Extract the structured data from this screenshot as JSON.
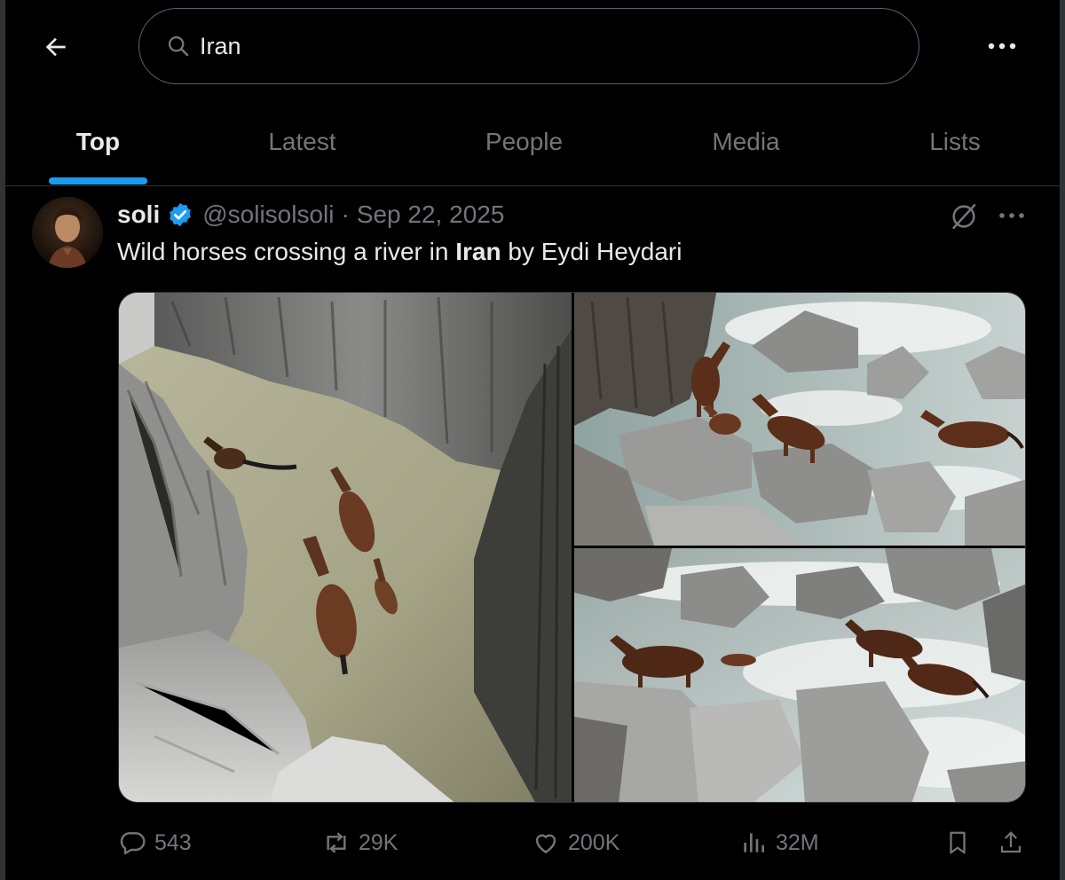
{
  "search": {
    "query": "Iran"
  },
  "tabs": [
    {
      "label": "Top",
      "active": true
    },
    {
      "label": "Latest",
      "active": false
    },
    {
      "label": "People",
      "active": false
    },
    {
      "label": "Media",
      "active": false
    },
    {
      "label": "Lists",
      "active": false
    }
  ],
  "post": {
    "author": "soli",
    "verified": true,
    "handle": "@solisolsoli",
    "separator": "·",
    "date": "Sep 22, 2025",
    "text_before": "Wild horses crossing a river in ",
    "text_highlight": "Iran",
    "text_after": " by Eydi Heydari",
    "media_count": 3,
    "actions": {
      "replies": "543",
      "reposts": "29K",
      "likes": "200K",
      "views": "32M"
    }
  },
  "icons": {
    "back": "arrow-left-icon",
    "search": "search-icon",
    "more": "more-horizontal-icon",
    "grok": "grok-icon",
    "reply": "reply-icon",
    "repost": "repost-icon",
    "like": "heart-icon",
    "views": "views-icon",
    "bookmark": "bookmark-icon",
    "share": "share-icon"
  },
  "colors": {
    "background": "#000000",
    "accent": "#1d9bf0",
    "text_primary": "#e7e9ea",
    "text_secondary": "#71767b",
    "border": "#2f3336"
  }
}
